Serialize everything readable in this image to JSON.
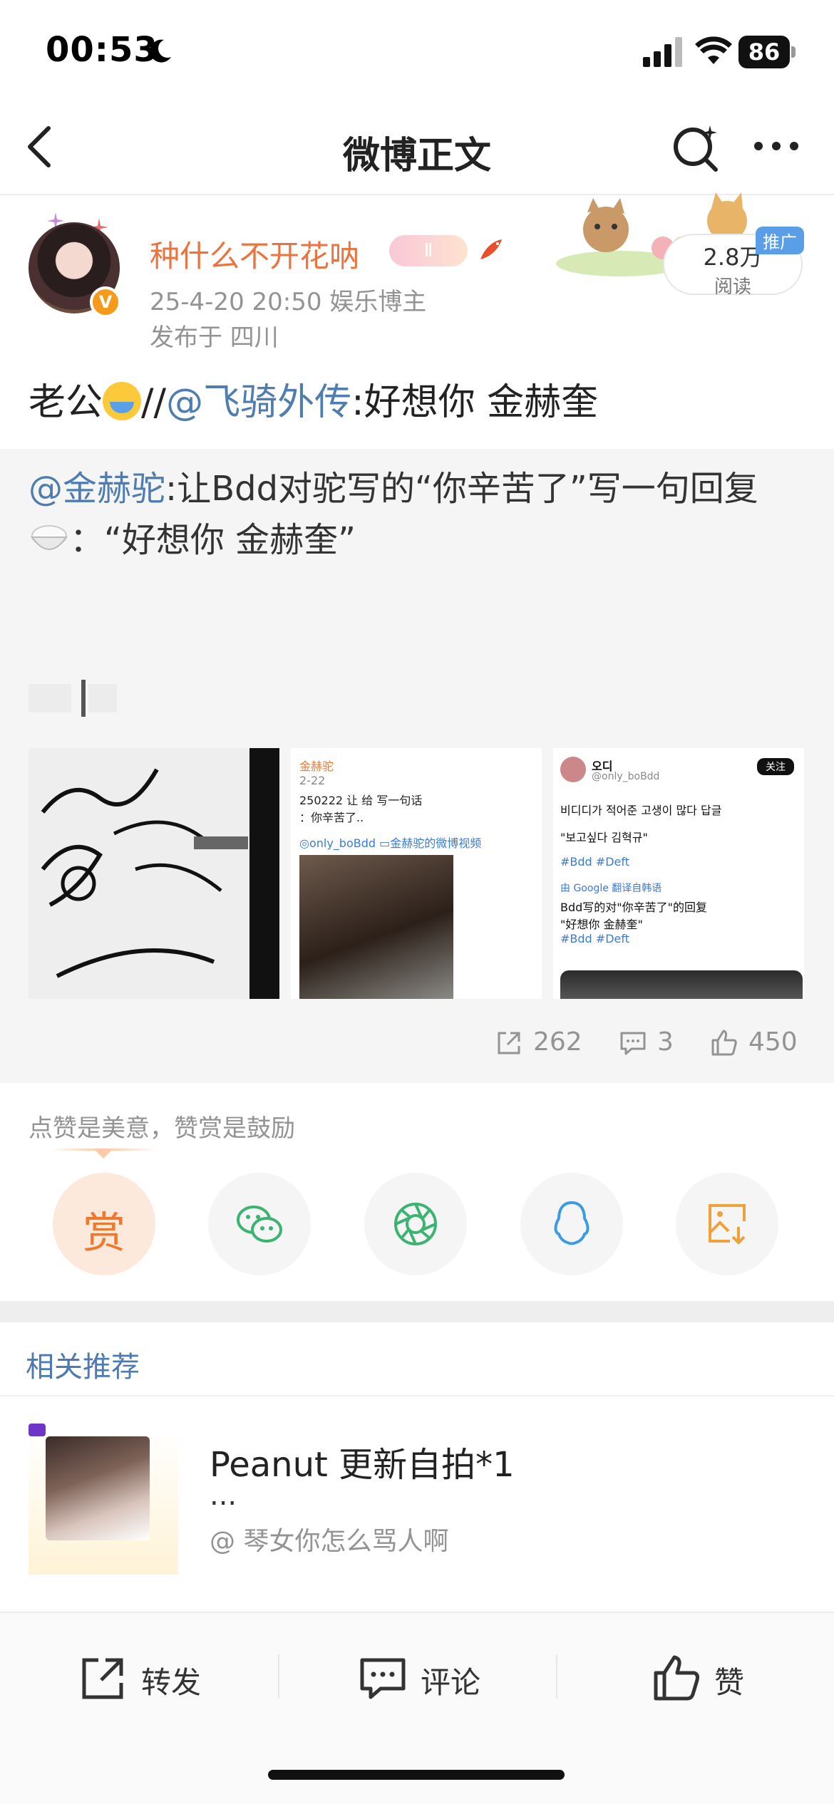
{
  "status_bar": {
    "time": "00:53",
    "battery": "86"
  },
  "nav": {
    "title": "微博正文"
  },
  "post": {
    "author": "种什么不开花呐",
    "meta": "25-4-20 20:50  娱乐博主",
    "location": "发布于 四川",
    "read_count": "2.8万",
    "read_label": "阅读",
    "promo_tag": "推广",
    "body_prefix": "老公",
    "body_sep": "//",
    "body_mention": "@飞骑外传",
    "body_text": ":好想你 金赫奎"
  },
  "repost": {
    "mention": "@金赫驼",
    "text_line1": ":让Bdd对驼写的“你辛苦了”写一句回复",
    "text_line2": "：“好想你 金赫奎”",
    "thumb2": {
      "author": "金赫驼",
      "date": "2-22",
      "line1": "250222 让  给  写一句话",
      "line2": "：你辛苦了..",
      "line3": "◎only_boBdd ▭金赫驼的微博视频"
    },
    "thumb3": {
      "name": "오디",
      "handle": "@only_boBdd",
      "follow": "关注",
      "line1": "비디디가 적어준 고생이 많다 답글",
      "line2": "\"보고싶다 김혁규\"",
      "line3": "#Bdd #Deft",
      "line4": "由 Google 翻译自韩语",
      "line5": "Bdd写的对\"你辛苦了\"的回复",
      "line6": "\"好想你 金赫奎\"",
      "line7": "#Bdd #Deft"
    },
    "stats": {
      "reposts": "262",
      "comments": "3",
      "likes": "450"
    }
  },
  "reward": {
    "hint": "点赞是美意，赞赏是鼓励",
    "reward_label": "赏"
  },
  "related": {
    "title": "相关推荐",
    "item": {
      "title": "Peanut 更新自拍*1",
      "ellipsis": "...",
      "author": "@ 琴女你怎么骂人啊"
    }
  },
  "toolbar": {
    "repost": "转发",
    "comment": "评论",
    "like": "赞"
  },
  "colors": {
    "accent_orange": "#eb7340",
    "link_blue": "#507daf",
    "stat_gray": "#939393"
  },
  "icons": {
    "share": [
      "wechat-icon",
      "moments-icon",
      "qq-icon",
      "save-image-icon"
    ]
  }
}
